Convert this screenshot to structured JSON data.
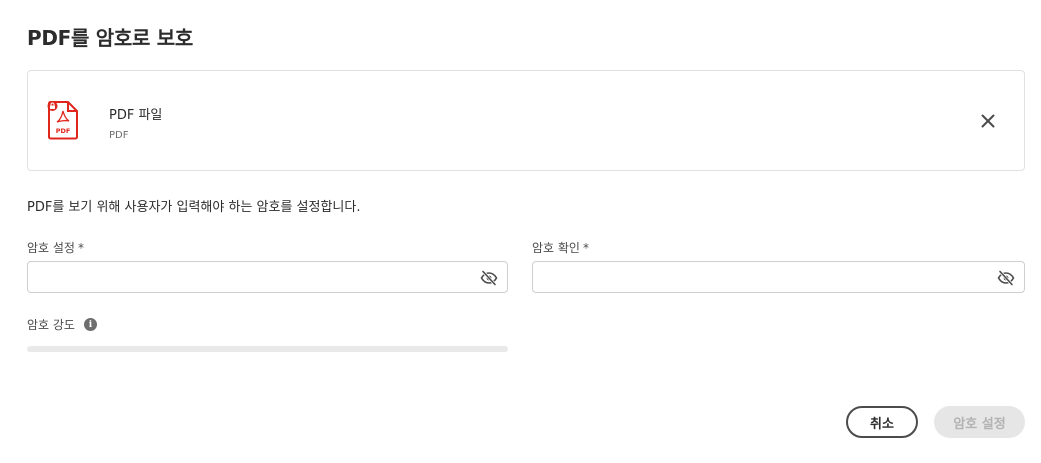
{
  "dialog": {
    "title": "PDF를 암호로 보호"
  },
  "file": {
    "name": "PDF 파일",
    "type": "PDF",
    "icon": "pdf-file-icon",
    "icon_badge_text": "PDF",
    "accent_color": "#e0251b"
  },
  "description": "PDF를 보기 위해 사용자가 입력해야 하는 암호를 설정합니다.",
  "password": {
    "label": "암호 설정",
    "required_mark": "*",
    "value": "",
    "toggle_icon": "eye-off-icon"
  },
  "confirm": {
    "label": "암호 확인",
    "required_mark": "*",
    "value": "",
    "toggle_icon": "eye-off-icon"
  },
  "strength": {
    "label": "암호 강도",
    "info_icon": "info-icon",
    "level": 0
  },
  "buttons": {
    "cancel": "취소",
    "submit": "암호 설정"
  }
}
